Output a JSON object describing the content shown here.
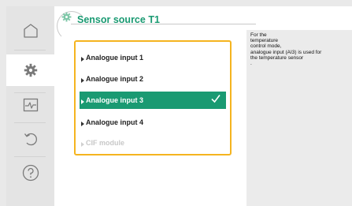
{
  "header": {
    "title": "Sensor source T1"
  },
  "options": [
    {
      "label": "Analogue input 1",
      "state": "normal"
    },
    {
      "label": "Analogue input 2",
      "state": "normal"
    },
    {
      "label": "Analogue input 3",
      "state": "selected"
    },
    {
      "label": "Analogue input 4",
      "state": "normal"
    },
    {
      "label": "CIF module",
      "state": "disabled"
    }
  ],
  "info": {
    "text": "For the\ntemperature\ncontrol mode,\nanalogue input (AI3) is used for\nthe temperature sensor\n."
  },
  "sidebar": {
    "items": [
      {
        "icon": "home-icon",
        "active": false
      },
      {
        "icon": "settings-icon",
        "active": true
      },
      {
        "icon": "diagnostics-icon",
        "active": false
      },
      {
        "icon": "restore-icon",
        "active": false
      },
      {
        "icon": "help-icon",
        "active": false
      }
    ]
  },
  "colors": {
    "accent": "#1a9a72",
    "focus_border": "#f5b41f",
    "sidebar": "#e4e4e4",
    "info_panel": "#ebebeb"
  }
}
